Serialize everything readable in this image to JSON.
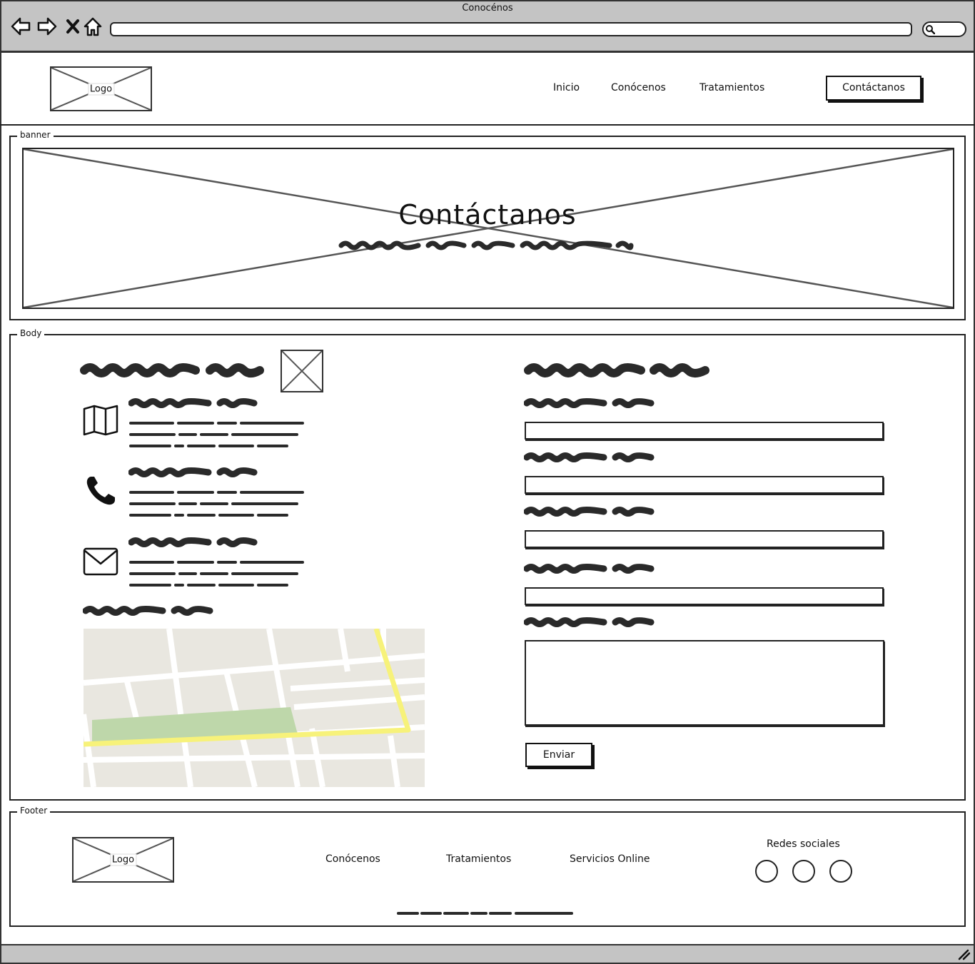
{
  "window": {
    "title": "Conocénos"
  },
  "header": {
    "logo_label": "Logo",
    "nav": [
      "Inicio",
      "Conócenos",
      "Tratamientos"
    ],
    "cta_label": "Contáctanos"
  },
  "banner": {
    "group_label": "banner",
    "title": "Contáctanos"
  },
  "body": {
    "group_label": "Body"
  },
  "form": {
    "submit_label": "Enviar"
  },
  "footer": {
    "group_label": "Footer",
    "logo_label": "Logo",
    "links": [
      "Conócenos",
      "Tratamientos",
      "Servicios Online"
    ],
    "social_title": "Redes sociales"
  },
  "colors": {
    "map_bg": "#e9e7e0",
    "map_road": "#ffffff",
    "map_highway": "#f7f27a",
    "map_park": "#bed7aa",
    "chrome": "#c4c4c4"
  },
  "icons": [
    "back-arrow-icon",
    "forward-arrow-icon",
    "close-icon",
    "home-icon",
    "search-icon",
    "map-icon",
    "phone-icon",
    "envelope-icon",
    "resize-grip-icon"
  ]
}
